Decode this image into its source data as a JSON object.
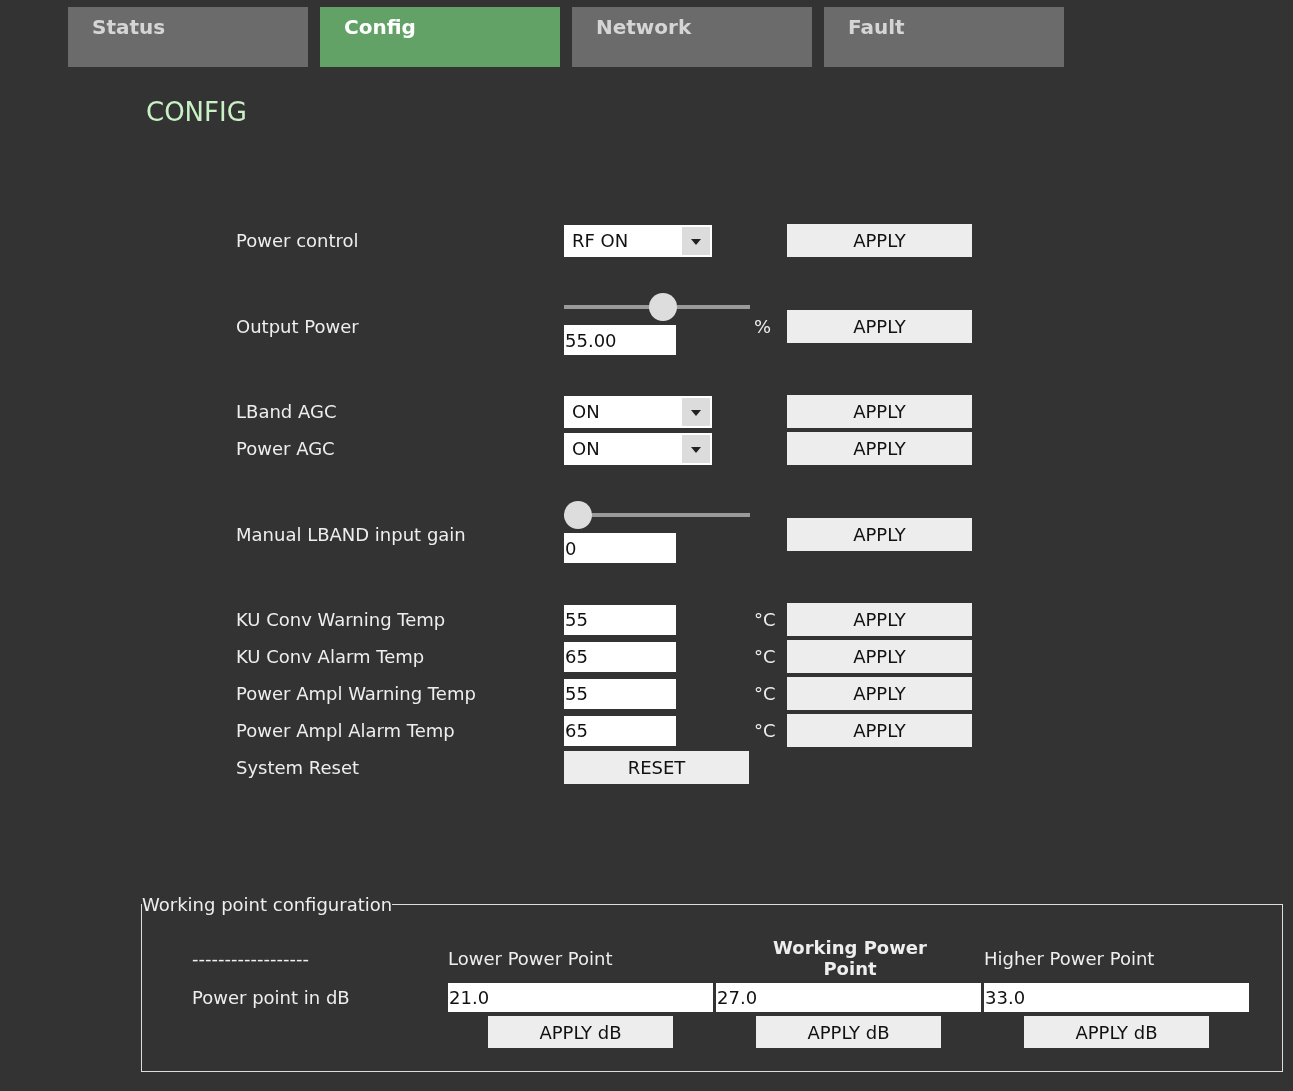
{
  "tabs": [
    {
      "label": "Status",
      "selected": false
    },
    {
      "label": "Config",
      "selected": true
    },
    {
      "label": "Network",
      "selected": false
    },
    {
      "label": "Fault",
      "selected": false
    }
  ],
  "heading": "CONFIG",
  "groups": [
    {
      "rows": [
        {
          "kind": "select",
          "label": "Power control",
          "value": "RF ON",
          "button": "APPLY"
        }
      ]
    },
    {
      "rows": [
        {
          "kind": "slider",
          "label": "Output Power",
          "level": 0.54,
          "value": "55.00",
          "unit": "%",
          "button": "APPLY"
        }
      ]
    },
    {
      "rows": [
        {
          "kind": "select",
          "label": "LBand AGC",
          "value": "ON",
          "button": "APPLY"
        },
        {
          "kind": "select",
          "label": "Power AGC",
          "value": "ON",
          "button": "APPLY"
        }
      ]
    },
    {
      "rows": [
        {
          "kind": "slider",
          "label": "Manual LBAND input gain",
          "level": 0,
          "value": "0",
          "button": "APPLY"
        }
      ]
    },
    {
      "rows": [
        {
          "kind": "text",
          "label": "KU Conv Warning Temp",
          "value": "55",
          "unit": "°C",
          "button": "APPLY"
        },
        {
          "kind": "text",
          "label": "KU Conv Alarm Temp",
          "value": "65",
          "unit": "°C",
          "button": "APPLY"
        },
        {
          "kind": "text",
          "label": "Power Ampl Warning Temp",
          "value": "55",
          "unit": "°C",
          "button": "APPLY"
        },
        {
          "kind": "text",
          "label": "Power Ampl Alarm Temp",
          "value": "65",
          "unit": "°C",
          "button": "APPLY"
        },
        {
          "kind": "action",
          "label": "System Reset",
          "action": "RESET"
        }
      ]
    }
  ],
  "working_point": {
    "legend": "Working point configuration",
    "corner": "------------------",
    "row_label": "Power point in dB",
    "columns": [
      {
        "heading": "Lower Power Point",
        "selected": false,
        "value": "21.0",
        "button": "APPLY dB"
      },
      {
        "heading": "Working Power Point",
        "selected": true,
        "value": "27.0",
        "button": "APPLY dB"
      },
      {
        "heading": "Higher Power Point",
        "selected": false,
        "value": "33.0",
        "button": "APPLY dB"
      }
    ]
  }
}
